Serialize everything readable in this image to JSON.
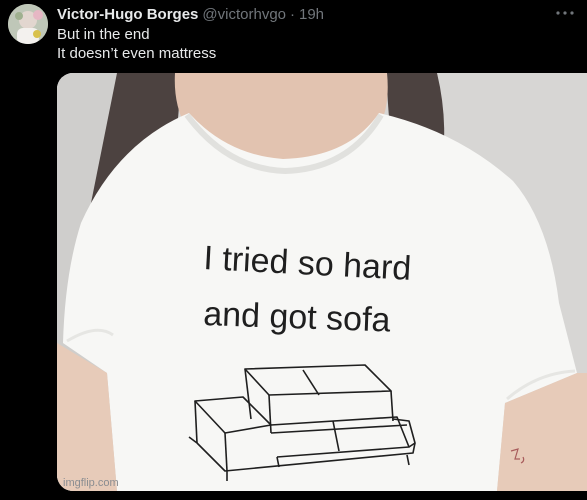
{
  "tweet": {
    "author_name": "Victor-Hugo Borges",
    "handle": "@victorhvgo",
    "separator": "·",
    "time": "19h",
    "text_lines": [
      "But in the end",
      "It doesn’t even mattress"
    ],
    "more_icon": "more-dots-icon"
  },
  "media": {
    "shirt_text_lines": [
      "I tried so hard",
      "and got sofa"
    ],
    "shirt_icon": "sofa-drawing-icon"
  },
  "watermark": "imgflip.com",
  "colors": {
    "background": "#000000",
    "primary_text": "#e7e9ea",
    "secondary_text": "#71767b",
    "photo_background": "#d5d5d3",
    "shirt": "#f7f7f5"
  }
}
